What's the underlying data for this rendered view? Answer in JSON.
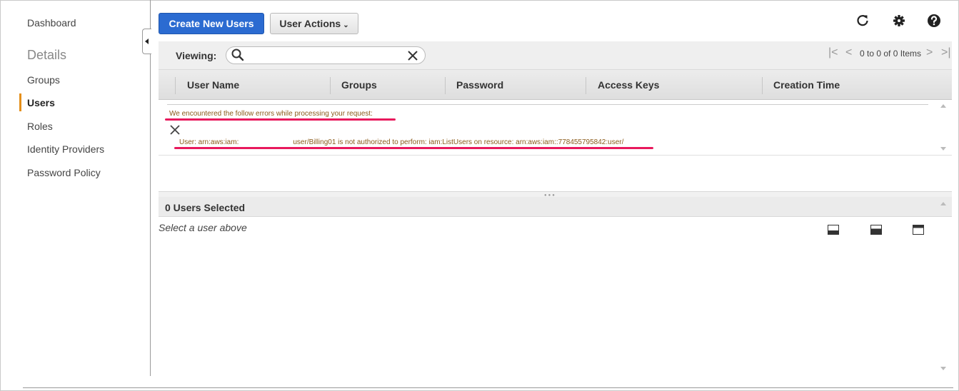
{
  "sidebar": {
    "dashboard": "Dashboard",
    "section_heading": "Details",
    "items": [
      {
        "label": "Groups"
      },
      {
        "label": "Users"
      },
      {
        "label": "Roles"
      },
      {
        "label": "Identity Providers"
      },
      {
        "label": "Password Policy"
      }
    ],
    "active_item": "Users",
    "accent_color": "#e48f1a"
  },
  "toolbar": {
    "create_label": "Create New Users",
    "actions_label": "User Actions",
    "icons": [
      "refresh-icon",
      "gear-icon",
      "help-icon"
    ]
  },
  "viewing": {
    "label": "Viewing:",
    "search_value": "",
    "pager_text": "0 to 0 of 0 Items"
  },
  "table": {
    "columns": [
      "User Name",
      "Groups",
      "Password",
      "Access Keys",
      "Creation Time"
    ]
  },
  "error": {
    "heading": "We encountered the follow errors while processing your request:",
    "message_prefix": "User: arn:aws:iam:",
    "message_suffix": "user/Billing01 is not authorized to perform: iam:ListUsers on resource: arn:aws:iam::778455795842:user/",
    "highlight_color": "#e8195c"
  },
  "detail_panel": {
    "title": "0 Users Selected",
    "note": "Select a user above"
  },
  "colors": {
    "primary_button": "#2b6bd1",
    "error_text": "#8a5a1a"
  }
}
